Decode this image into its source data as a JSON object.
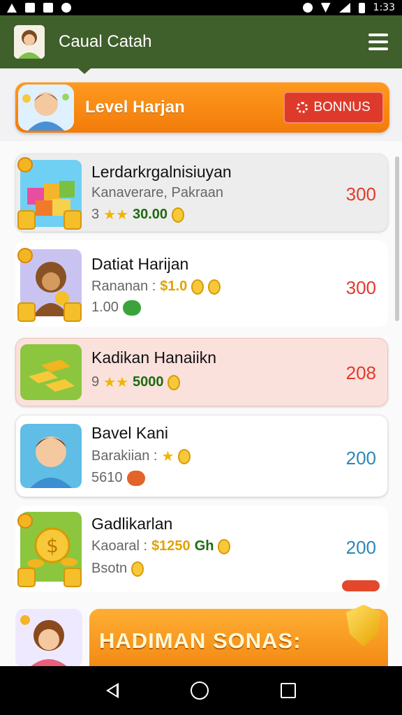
{
  "status_bar": {
    "time": "1:33"
  },
  "app_bar": {
    "title": "Caual Catah"
  },
  "level_banner": {
    "title": "Level Harjan",
    "bonus_button_label": "BONNUS"
  },
  "cards": [
    {
      "title": "Lerdarkrgalnisiuyan",
      "line1": "Kanaverare, Pakraan",
      "line2_prefix": "3",
      "line2_value": "30.00",
      "points": "300"
    },
    {
      "title": "Datiat Harijan",
      "line1_prefix": "Rananan :",
      "line1_value": "$1.0",
      "line2": "1.00",
      "points": "300"
    },
    {
      "title": "Kadikan Hanaiikn",
      "line1_prefix": "9",
      "line1_value": "5000",
      "points": "208"
    },
    {
      "title": "Bavel Kani",
      "line1_prefix": "Barakiian :",
      "line2": "5610",
      "points": "200"
    },
    {
      "title": "Gadlikarlan",
      "line1_prefix": "Kaoaral :",
      "line1_value": "$1250",
      "line1_extra": "Gh",
      "line2": "Bsotn",
      "points": "200"
    }
  ],
  "bonus_card": {
    "label": "HADIMAN SONAS:"
  },
  "colors": {
    "app_bar": "#3f5f2b",
    "accent_orange": "#f28a14",
    "points_red": "#e23a2a",
    "points_blue": "#2f86b5"
  },
  "icons": [
    "warning-icon",
    "image-icon",
    "phone-icon",
    "whatsapp-icon",
    "alarm-icon",
    "wifi-icon",
    "signal-icon",
    "battery-icon",
    "menu-icon",
    "gear-icon",
    "star-icon",
    "coin-icon",
    "shield-icon",
    "back-icon",
    "home-icon",
    "recents-icon"
  ]
}
